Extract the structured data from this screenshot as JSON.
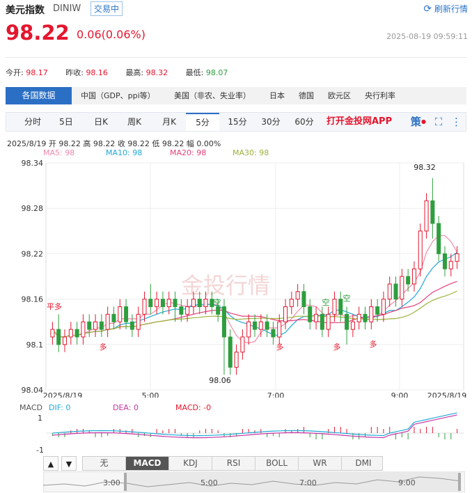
{
  "header": {
    "name": "美元指数",
    "code": "DINIW",
    "status": "交易中",
    "refresh": "刷新行情",
    "price": "98.22",
    "change": "0.06(0.06%)",
    "time": "2025-08-19 09:59:11"
  },
  "stats": {
    "open_label": "今开:",
    "open": "98.17",
    "prev_label": "昨收:",
    "prev": "98.16",
    "high_label": "最高:",
    "high": "98.32",
    "low_label": "最低:",
    "low": "98.07"
  },
  "data_tabs": [
    "各国数据",
    "中国（GDP、ppi等）",
    "美国（非农、失业率）",
    "日本",
    "德国",
    "欧元区",
    "央行利率"
  ],
  "period_tabs": [
    "分时",
    "5日",
    "日K",
    "周K",
    "月K",
    "5分",
    "15分",
    "30分",
    "60分"
  ],
  "selected_period": "5分",
  "app_link": "打开金投网APP",
  "tool_icons": [
    "strategy-icon",
    "fullscreen-icon",
    "more-icon"
  ],
  "ohlc_line": "2025/8/19  开 98.22  高 98.22  收 98.22  低 98.22  幅 0.00%",
  "ma_legend": [
    {
      "label": "MA5: 98",
      "color": "#f08aa8"
    },
    {
      "label": "MA10: 98",
      "color": "#22a9d6"
    },
    {
      "label": "MA20: 98",
      "color": "#e4407b"
    },
    {
      "label": "MA30: 98",
      "color": "#9bb23a"
    }
  ],
  "watermark": "金投行情",
  "colors": {
    "up": "#e4162e",
    "down": "#2e9e3e",
    "accent": "#2b6fc4"
  },
  "chart_data": {
    "type": "candlestick",
    "y_ticks": [
      "98.34",
      "98.28",
      "98.22",
      "98.16",
      "98.1",
      "98.04"
    ],
    "ylim": [
      98.04,
      98.34
    ],
    "x_ticks": [
      "2025/8/19",
      "5:00",
      "7:00",
      "9:00",
      "2025/8/19"
    ],
    "annotations": [
      {
        "text": "98.32",
        "kind": "max"
      },
      {
        "text": "98.06",
        "kind": "min"
      },
      {
        "text": "平多"
      },
      {
        "text": "多"
      },
      {
        "text": "空"
      },
      {
        "text": "空"
      },
      {
        "text": "空"
      },
      {
        "text": "多"
      },
      {
        "text": "多"
      },
      {
        "text": "多"
      }
    ],
    "candles": [
      [
        98.11,
        98.12,
        98.1,
        98.13
      ],
      [
        98.12,
        98.1,
        98.09,
        98.14
      ],
      [
        98.1,
        98.11,
        98.09,
        98.12
      ],
      [
        98.11,
        98.12,
        98.1,
        98.13
      ],
      [
        98.12,
        98.11,
        98.1,
        98.13
      ],
      [
        98.11,
        98.13,
        98.1,
        98.14
      ],
      [
        98.13,
        98.12,
        98.11,
        98.14
      ],
      [
        98.12,
        98.13,
        98.11,
        98.14
      ],
      [
        98.13,
        98.12,
        98.11,
        98.14
      ],
      [
        98.12,
        98.14,
        98.11,
        98.15
      ],
      [
        98.14,
        98.13,
        98.12,
        98.15
      ],
      [
        98.13,
        98.15,
        98.12,
        98.16
      ],
      [
        98.15,
        98.13,
        98.12,
        98.16
      ],
      [
        98.13,
        98.12,
        98.11,
        98.14
      ],
      [
        98.12,
        98.14,
        98.11,
        98.15
      ],
      [
        98.14,
        98.16,
        98.13,
        98.17
      ],
      [
        98.16,
        98.15,
        98.14,
        98.18
      ],
      [
        98.15,
        98.16,
        98.14,
        98.17
      ],
      [
        98.16,
        98.15,
        98.14,
        98.17
      ],
      [
        98.15,
        98.16,
        98.14,
        98.17
      ],
      [
        98.16,
        98.15,
        98.13,
        98.17
      ],
      [
        98.15,
        98.14,
        98.13,
        98.16
      ],
      [
        98.14,
        98.15,
        98.13,
        98.16
      ],
      [
        98.15,
        98.16,
        98.14,
        98.17
      ],
      [
        98.16,
        98.15,
        98.14,
        98.17
      ],
      [
        98.15,
        98.16,
        98.14,
        98.17
      ],
      [
        98.16,
        98.15,
        98.14,
        98.17
      ],
      [
        98.15,
        98.14,
        98.13,
        98.16
      ],
      [
        98.15,
        98.11,
        98.06,
        98.16
      ],
      [
        98.11,
        98.07,
        98.06,
        98.12
      ],
      [
        98.07,
        98.09,
        98.06,
        98.1
      ],
      [
        98.09,
        98.11,
        98.08,
        98.12
      ],
      [
        98.11,
        98.13,
        98.1,
        98.14
      ],
      [
        98.13,
        98.12,
        98.11,
        98.14
      ],
      [
        98.12,
        98.13,
        98.11,
        98.14
      ],
      [
        98.13,
        98.12,
        98.11,
        98.14
      ],
      [
        98.12,
        98.11,
        98.1,
        98.13
      ],
      [
        98.11,
        98.13,
        98.1,
        98.14
      ],
      [
        98.13,
        98.15,
        98.12,
        98.16
      ],
      [
        98.15,
        98.16,
        98.14,
        98.17
      ],
      [
        98.16,
        98.17,
        98.15,
        98.18
      ],
      [
        98.17,
        98.15,
        98.14,
        98.18
      ],
      [
        98.15,
        98.13,
        98.12,
        98.16
      ],
      [
        98.13,
        98.14,
        98.12,
        98.15
      ],
      [
        98.14,
        98.12,
        98.11,
        98.15
      ],
      [
        98.12,
        98.14,
        98.11,
        98.15
      ],
      [
        98.14,
        98.16,
        98.13,
        98.17
      ],
      [
        98.16,
        98.14,
        98.13,
        98.17
      ],
      [
        98.14,
        98.12,
        98.1,
        98.15
      ],
      [
        98.12,
        98.13,
        98.11,
        98.14
      ],
      [
        98.13,
        98.14,
        98.12,
        98.15
      ],
      [
        98.14,
        98.13,
        98.12,
        98.15
      ],
      [
        98.13,
        98.15,
        98.12,
        98.16
      ],
      [
        98.15,
        98.14,
        98.13,
        98.16
      ],
      [
        98.14,
        98.16,
        98.13,
        98.17
      ],
      [
        98.16,
        98.18,
        98.15,
        98.19
      ],
      [
        98.18,
        98.16,
        98.15,
        98.19
      ],
      [
        98.16,
        98.19,
        98.15,
        98.2
      ],
      [
        98.19,
        98.18,
        98.17,
        98.2
      ],
      [
        98.18,
        98.2,
        98.17,
        98.21
      ],
      [
        98.2,
        98.25,
        98.19,
        98.26
      ],
      [
        98.25,
        98.29,
        98.24,
        98.3
      ],
      [
        98.29,
        98.26,
        98.24,
        98.32
      ],
      [
        98.26,
        98.22,
        98.21,
        98.27
      ],
      [
        98.22,
        98.2,
        98.19,
        98.23
      ],
      [
        98.2,
        98.21,
        98.19,
        98.22
      ],
      [
        98.21,
        98.22,
        98.2,
        98.23
      ]
    ],
    "macd": {
      "y_ticks": [
        "1",
        "-1"
      ],
      "labels": {
        "dif": "DIF: 0",
        "dea": "DEA: 0",
        "macd": "MACD: -0"
      }
    },
    "macd_title": "MACD"
  },
  "indicator_tabs": [
    "无",
    "MACD",
    "KDJ",
    "RSI",
    "BOLL",
    "WR",
    "DMI"
  ],
  "selected_indicator": "MACD",
  "navigator_ticks": [
    "3:00",
    "5:00",
    "7:00",
    "9:00"
  ]
}
